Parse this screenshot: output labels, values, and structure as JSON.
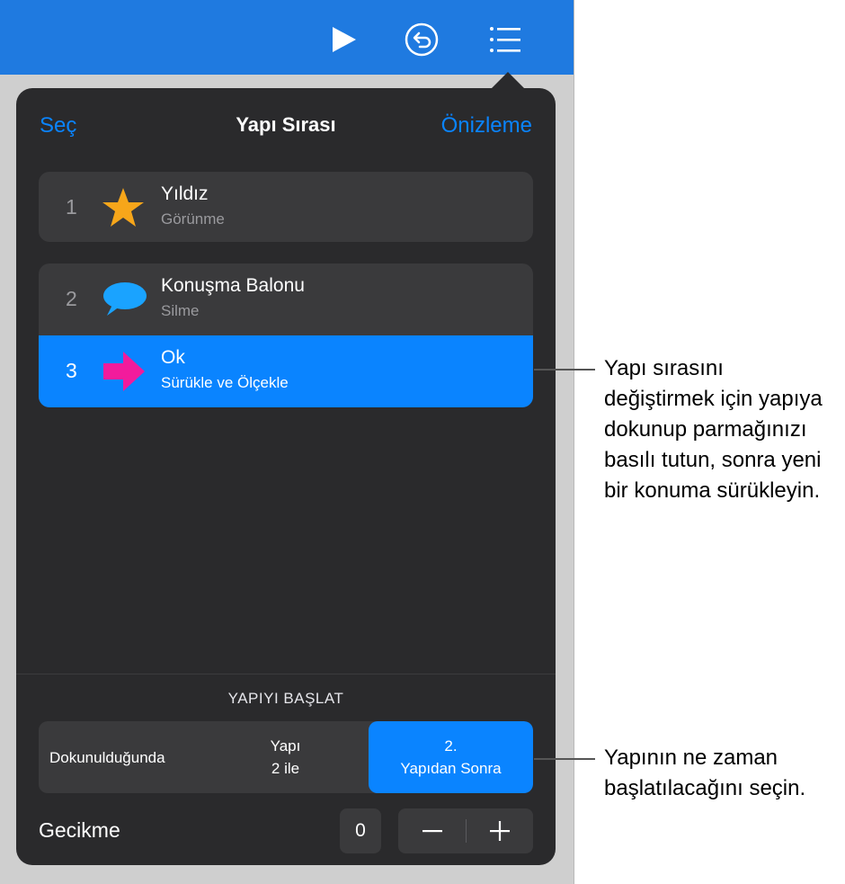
{
  "toolbar": {
    "icons": [
      "play-icon",
      "undo-icon",
      "list-icon"
    ]
  },
  "popover": {
    "header": {
      "left": "Seç",
      "title": "Yapı Sırası",
      "right": "Önizleme"
    },
    "builds": [
      {
        "number": "1",
        "title": "Yıldız",
        "subtitle": "Görünme",
        "icon": "star-icon",
        "icon_color": "#f7a61a"
      },
      {
        "number": "2",
        "title": "Konuşma Balonu",
        "subtitle": "Silme",
        "icon": "speech-bubble-icon",
        "icon_color": "#1aa3ff"
      },
      {
        "number": "3",
        "title": "Ok",
        "subtitle": "Sürükle ve Ölçekle",
        "icon": "arrow-icon",
        "icon_color": "#f21b9c",
        "selected": true
      }
    ],
    "start": {
      "label": "YAPIYI BAŞLAT",
      "options": [
        {
          "line1": "Dokunulduğunda",
          "line2": ""
        },
        {
          "line1": "Yapı",
          "line2": "2 ile"
        },
        {
          "line1": "2.",
          "line2": "Yapıdan Sonra"
        }
      ],
      "selected_index": 2
    },
    "delay": {
      "label": "Gecikme",
      "value": "0"
    }
  },
  "callouts": [
    {
      "text": "Yapı sırasını değiştirmek için yapıya dokunup parmağınızı basılı tutun, sonra yeni bir konuma sürükleyin."
    },
    {
      "text": "Yapının ne zaman başlatılacağını seçin."
    }
  ],
  "colors": {
    "toolbar": "#1f7ae0",
    "accent": "#0a84ff",
    "popover_bg": "#2a2a2c",
    "row_bg": "#3a3a3c"
  }
}
